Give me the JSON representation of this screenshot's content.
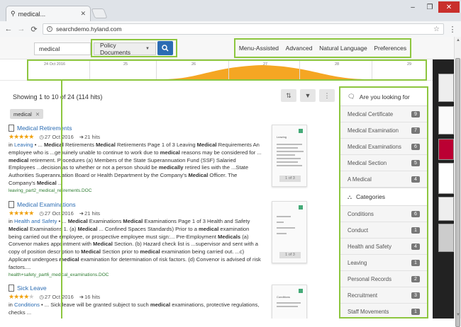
{
  "browser": {
    "tab_title": "medical...",
    "url": "searchdemo.hyland.com",
    "window_controls": {
      "minimize": "–",
      "maximize": "❐",
      "close": "✕"
    }
  },
  "search": {
    "query": "medical",
    "dropdown_value": "Policy Documents",
    "nav_links": [
      "Menu-Assisted",
      "Advanced",
      "Natural Language",
      "Preferences"
    ]
  },
  "timeline": {
    "labels": [
      "24 Oct 2016",
      "25",
      "26",
      "27",
      "28",
      "29"
    ]
  },
  "results_header": {
    "text": "Showing 1 to 10 of 24 (114 hits)",
    "chip": "medical",
    "chip_close": "✕"
  },
  "results": [
    {
      "title": "Medical Retirements",
      "rating": 5,
      "date": "27 Oct 2016",
      "hits": "21 hits",
      "prefix": "in ",
      "category": "Leaving",
      "body": " • ... Medical Retirements Medical Retirements Page 1 of 3 Leaving Medical Requirements An employee who is ...genuinely unable to continue to work due to medical reasons may be considered for ... medical retirement. Procedures (a) Members of the State Superannuation Fund (SSF) Salaried Employees ...decision as to whether or not a person should be medically retired lies with the ...State Authorities Superannuation Board or Health Department by the Company's Medical Officer. The Company's Medical ...",
      "file": "leaving_part2_medical_retirements.DOC",
      "preview_title": "Leaving",
      "preview_page": "1 of 3"
    },
    {
      "title": "Medical Examinations",
      "rating": 5,
      "date": "27 Oct 2016",
      "hits": "21 hits",
      "prefix": "in ",
      "category": "Health and Safety",
      "body": " • ... Medical Examinations Medical Examinations Page 1 of 3 Health and Safety Medical Examinations 1. (a) Medical ... Confined Spaces Standards) Prior to a medical examination being carried out the employee, or prospective employee must sign:... Pre-Employment Medicals (a) Convenor makes appointment with Medical Section. (b) Hazard check list is ...supervisor and sent with a copy of position description to Medical Section prior to medical examination being carried out. ...c) Applicant undergoes medical examination for determination of risk factors. (d) Convenor is advised of risk factors....",
      "file": "health+safety_part6_medical_examinations.DOC",
      "preview_title": "",
      "preview_page": "1 of 3"
    },
    {
      "title": "Sick Leave",
      "rating": 4,
      "date": "27 Oct 2016",
      "hits": "16 hits",
      "prefix": "in ",
      "category": "Conditions",
      "body": " • ... Sick leave will be granted subject to such medical examinations, protective regulations, checks ...",
      "file": "",
      "preview_title": "Conditions",
      "preview_page": ""
    }
  ],
  "sidebar": {
    "heading": "Are you looking for",
    "suggestions": [
      {
        "label": "Medical Certificate",
        "count": "9"
      },
      {
        "label": "Medical Examination",
        "count": "7"
      },
      {
        "label": "Medical Examinations",
        "count": "6"
      },
      {
        "label": "Medical Section",
        "count": "5"
      },
      {
        "label": "A Medical",
        "count": "4"
      }
    ],
    "categories_heading": "Categories",
    "categories": [
      {
        "label": "Conditions",
        "count": "6"
      },
      {
        "label": "Conduct",
        "count": "1"
      },
      {
        "label": "Health and Safety",
        "count": "4"
      },
      {
        "label": "Leaving",
        "count": "1"
      },
      {
        "label": "Personal Records",
        "count": "2"
      },
      {
        "label": "Recruitment",
        "count": "3"
      },
      {
        "label": "Staff Movements",
        "count": "1"
      }
    ]
  },
  "colors": {
    "accent": "#2b6cb3",
    "highlight": "#8dc63f",
    "star": "#f0a10b",
    "timeline_fill": "#f5a623"
  }
}
